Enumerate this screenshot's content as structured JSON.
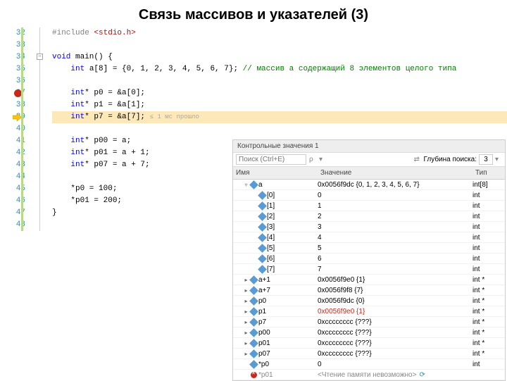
{
  "title": "Связь массивов и указателей (3)",
  "code": {
    "lines": [
      {
        "n": 32,
        "html": "<span class='inc'>#include </span><span class='str'>&lt;stdio.h&gt;</span>"
      },
      {
        "n": 33,
        "html": ""
      },
      {
        "n": 34,
        "html": "<span class='kw'>void</span> main() {",
        "fold": true
      },
      {
        "n": 35,
        "html": "    <span class='kw'>int</span> a[8] = {0, 1, 2, 3, 4, 5, 6, 7}; <span class='cmt'>// массив a содержащий 8 элементов целого типа</span>"
      },
      {
        "n": 36,
        "html": ""
      },
      {
        "n": 37,
        "html": "    <span class='kw'>int</span>* p0 = &a[0];",
        "bp": true
      },
      {
        "n": 38,
        "html": "    <span class='kw'>int</span>* p1 = &a[1];"
      },
      {
        "n": 39,
        "html": "    <span class='kw'>int</span>* p7 = &a[7]; <span class='hint'>≤ 1 мс прошло</span>",
        "cur": true
      },
      {
        "n": 40,
        "html": ""
      },
      {
        "n": 41,
        "html": "    <span class='kw'>int</span>* p00 = a;"
      },
      {
        "n": 42,
        "html": "    <span class='kw'>int</span>* p01 = a + 1;"
      },
      {
        "n": 43,
        "html": "    <span class='kw'>int</span>* p07 = a + 7;"
      },
      {
        "n": 44,
        "html": ""
      },
      {
        "n": 45,
        "html": "    *p0 = 100;"
      },
      {
        "n": 46,
        "html": "    *p01 = 200;"
      },
      {
        "n": 47,
        "html": "}"
      },
      {
        "n": 48,
        "html": ""
      }
    ]
  },
  "watch": {
    "title": "Контрольные значения 1",
    "search_ph": "Поиск (Ctrl+E)",
    "depth_label": "Глубина поиска:",
    "depth_value": "3",
    "cols": {
      "name": "Имя",
      "val": "Значение",
      "type": "Тип"
    },
    "rows": [
      {
        "exp": "▿",
        "ind": 1,
        "name": "a",
        "val": "0x0056f9dc {0, 1, 2, 3, 4, 5, 6, 7}",
        "type": "int[8]"
      },
      {
        "exp": "",
        "ind": 2,
        "name": "[0]",
        "val": "0",
        "type": "int"
      },
      {
        "exp": "",
        "ind": 2,
        "name": "[1]",
        "val": "1",
        "type": "int"
      },
      {
        "exp": "",
        "ind": 2,
        "name": "[2]",
        "val": "2",
        "type": "int"
      },
      {
        "exp": "",
        "ind": 2,
        "name": "[3]",
        "val": "3",
        "type": "int"
      },
      {
        "exp": "",
        "ind": 2,
        "name": "[4]",
        "val": "4",
        "type": "int"
      },
      {
        "exp": "",
        "ind": 2,
        "name": "[5]",
        "val": "5",
        "type": "int"
      },
      {
        "exp": "",
        "ind": 2,
        "name": "[6]",
        "val": "6",
        "type": "int"
      },
      {
        "exp": "",
        "ind": 2,
        "name": "[7]",
        "val": "7",
        "type": "int"
      },
      {
        "exp": "▸",
        "ind": 1,
        "name": "a+1",
        "val": "0x0056f9e0 {1}",
        "type": "int *"
      },
      {
        "exp": "▸",
        "ind": 1,
        "name": "a+7",
        "val": "0x0056f9f8 {7}",
        "type": "int *"
      },
      {
        "exp": "▸",
        "ind": 1,
        "name": "p0",
        "val": "0x0056f9dc {0}",
        "type": "int *"
      },
      {
        "exp": "▸",
        "ind": 1,
        "name": "p1",
        "val": "0x0056f9e0 {1}",
        "type": "int *",
        "red": true
      },
      {
        "exp": "▸",
        "ind": 1,
        "name": "p7",
        "val": "0xcccccccc {???}",
        "type": "int *"
      },
      {
        "exp": "▸",
        "ind": 1,
        "name": "p00",
        "val": "0xcccccccc {???}",
        "type": "int *"
      },
      {
        "exp": "▸",
        "ind": 1,
        "name": "p01",
        "val": "0xcccccccc {???}",
        "type": "int *"
      },
      {
        "exp": "▸",
        "ind": 1,
        "name": "p07",
        "val": "0xcccccccc {???}",
        "type": "int *"
      },
      {
        "exp": "",
        "ind": 1,
        "name": "*p0",
        "val": "0",
        "type": "int"
      },
      {
        "exp": "",
        "ind": 1,
        "name": "*p01",
        "val": "<Чтение памяти невозможно>",
        "type": "",
        "err": true,
        "gray": true,
        "refresh": true
      }
    ]
  }
}
